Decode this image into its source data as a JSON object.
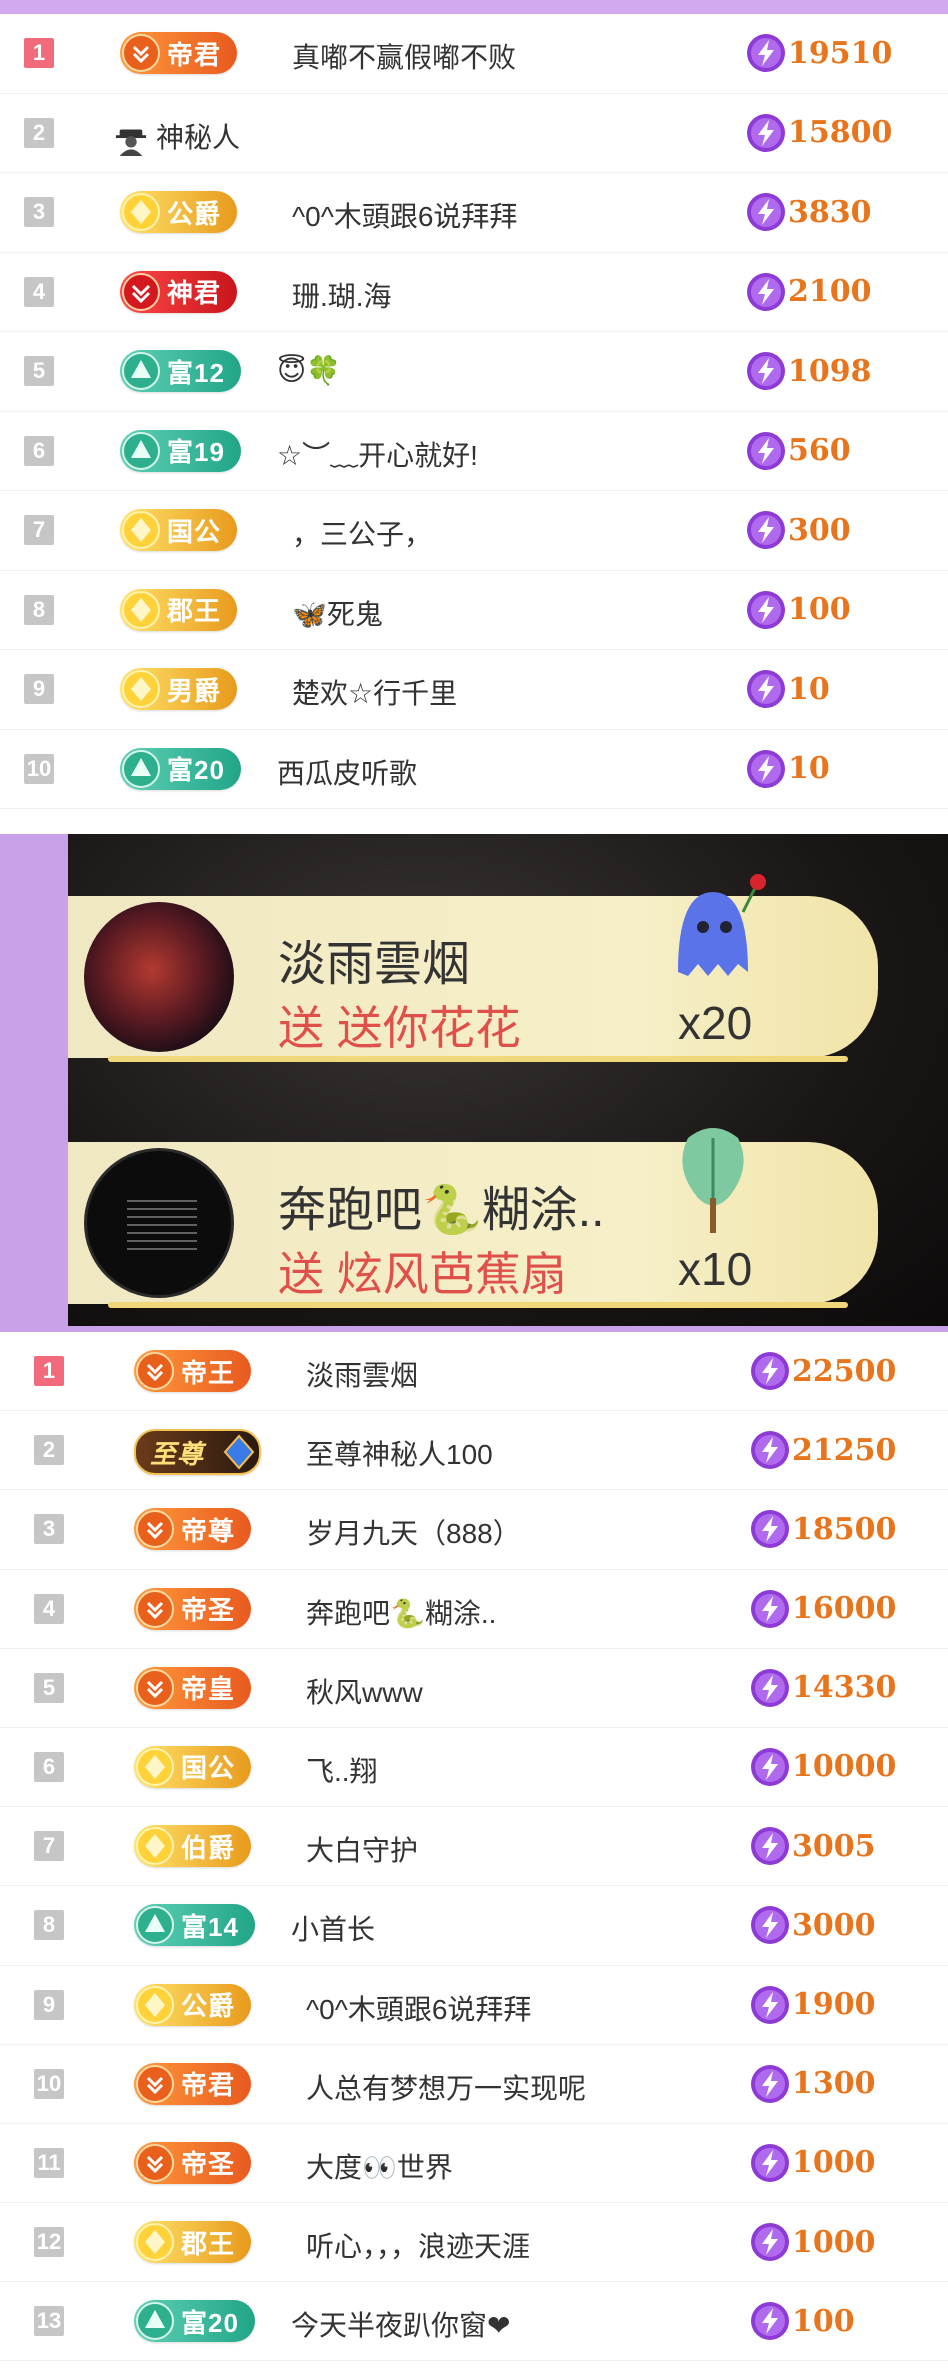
{
  "top_list": [
    {
      "rank": "1",
      "badge": "帝君",
      "badge_style": "red",
      "name": "真嘟不赢假嘟不败",
      "score": "19510",
      "name_prefix_icon": ""
    },
    {
      "rank": "2",
      "badge": "",
      "badge_style": "none",
      "name": "神秘人",
      "score": "15800",
      "name_prefix_icon": "mystery-person-icon"
    },
    {
      "rank": "3",
      "badge": "公爵",
      "badge_style": "gold",
      "name": "^0^木頭跟6说拜拜",
      "score": "3830",
      "name_prefix_icon": ""
    },
    {
      "rank": "4",
      "badge": "神君",
      "badge_style": "crimson",
      "name": "珊.瑚.海",
      "score": "2100",
      "name_prefix_icon": ""
    },
    {
      "rank": "5",
      "badge": "富12",
      "badge_style": "teal",
      "name": "😇🍀",
      "score": "1098",
      "name_prefix_icon": ""
    },
    {
      "rank": "6",
      "badge": "富19",
      "badge_style": "teal",
      "name": "☆︶﹏开心就好!",
      "score": "560",
      "name_prefix_icon": ""
    },
    {
      "rank": "7",
      "badge": "国公",
      "badge_style": "gold",
      "name": "，三公子，",
      "score": "300",
      "name_prefix_icon": ""
    },
    {
      "rank": "8",
      "badge": "郡王",
      "badge_style": "gold",
      "name": "🦋死鬼",
      "score": "100",
      "name_prefix_icon": ""
    },
    {
      "rank": "9",
      "badge": "男爵",
      "badge_style": "gold",
      "name": "楚欢☆行千里",
      "score": "10",
      "name_prefix_icon": ""
    },
    {
      "rank": "10",
      "badge": "富20",
      "badge_style": "teal",
      "name": "西瓜皮听歌",
      "score": "10",
      "name_prefix_icon": ""
    }
  ],
  "gifts": [
    {
      "sender": "淡雨雲烟",
      "action": "送 送你花花",
      "count": "x20",
      "gift_icon": "ghost-with-rose-icon"
    },
    {
      "sender": "奔跑吧🐍糊涂..",
      "action": "送 炫风芭蕉扇",
      "count": "x10",
      "gift_icon": "banana-fan-icon"
    }
  ],
  "bottom_list": [
    {
      "rank": "1",
      "badge": "帝王",
      "badge_style": "red",
      "name": "淡雨雲烟",
      "score": "22500"
    },
    {
      "rank": "2",
      "badge": "至尊",
      "badge_style": "supreme",
      "name": "至尊神秘人100",
      "score": "21250"
    },
    {
      "rank": "3",
      "badge": "帝尊",
      "badge_style": "red",
      "name": "岁月九天（888）",
      "score": "18500"
    },
    {
      "rank": "4",
      "badge": "帝圣",
      "badge_style": "red",
      "name": "奔跑吧🐍糊涂..",
      "score": "16000"
    },
    {
      "rank": "5",
      "badge": "帝皇",
      "badge_style": "red",
      "name": "秋风www",
      "score": "14330"
    },
    {
      "rank": "6",
      "badge": "国公",
      "badge_style": "gold",
      "name": "飞..翔",
      "score": "10000"
    },
    {
      "rank": "7",
      "badge": "伯爵",
      "badge_style": "gold",
      "name": "大白守护",
      "score": "3005"
    },
    {
      "rank": "8",
      "badge": "富14",
      "badge_style": "teal",
      "name": "小首长",
      "score": "3000"
    },
    {
      "rank": "9",
      "badge": "公爵",
      "badge_style": "gold",
      "name": "^0^木頭跟6说拜拜",
      "score": "1900"
    },
    {
      "rank": "10",
      "badge": "帝君",
      "badge_style": "red",
      "name": "人总有梦想万一实现呢",
      "score": "1300"
    },
    {
      "rank": "11",
      "badge": "帝圣",
      "badge_style": "red",
      "name": "大度👀世界",
      "score": "1000"
    },
    {
      "rank": "12",
      "badge": "郡王",
      "badge_style": "gold",
      "name": "听心，，，浪迹天涯",
      "score": "1000"
    },
    {
      "rank": "13",
      "badge": "富20",
      "badge_style": "teal",
      "name": "今天半夜趴你窗❤",
      "score": "100"
    }
  ],
  "colors": {
    "score": "#e8741c",
    "rank_first": "#f26b7c",
    "rank_other": "#c6c6c6",
    "accent_purple": "#c9a1e8"
  }
}
